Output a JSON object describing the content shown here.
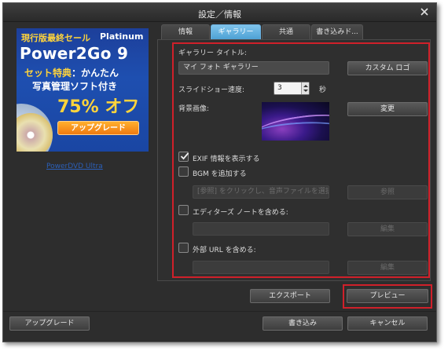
{
  "window": {
    "title": "設定／情報"
  },
  "promo": {
    "line1": "現行版最終セール",
    "line1b": "Platinum",
    "product": "Power2Go 9",
    "line3_highlight": "セット特典",
    "line3_rest": "：かんたん",
    "line4": "写真管理ソフト付き",
    "discount": "75% オフ",
    "button": "アップグレード",
    "link": "PowerDVD Ultra"
  },
  "tabs": [
    {
      "label": "情報"
    },
    {
      "label": "ギャラリー"
    },
    {
      "label": "共通"
    },
    {
      "label": "書き込みド..."
    }
  ],
  "gallery": {
    "title_label": "ギャラリー タイトル:",
    "title_value": "マイ フォト ギャラリー",
    "custom_logo_button": "カスタム ロゴ",
    "speed_label": "スライドショー速度:",
    "speed_value": "3",
    "speed_unit": "秒",
    "bg_label": "背景画像:",
    "change_button": "変更",
    "exif_label": "EXIF 情報を表示する",
    "exif_checked": true,
    "bgm_label": "BGM を追加する",
    "bgm_checked": false,
    "bgm_placeholder": "[参照] をクリックし、音声ファイルを選択してください",
    "browse_button": "参照",
    "editor_label": "エディターズ ノートを含める:",
    "editor_checked": false,
    "edit_button_1": "編集",
    "url_label": "外部 URL を含める:",
    "url_checked": false,
    "edit_button_2": "編集"
  },
  "actions": {
    "export": "エクスポート",
    "preview": "プレビュー",
    "upgrade": "アップグレード",
    "burn": "書き込み",
    "cancel": "キャンセル"
  },
  "colors": {
    "accent": "#4b9fd3",
    "highlight": "#d0202a"
  }
}
